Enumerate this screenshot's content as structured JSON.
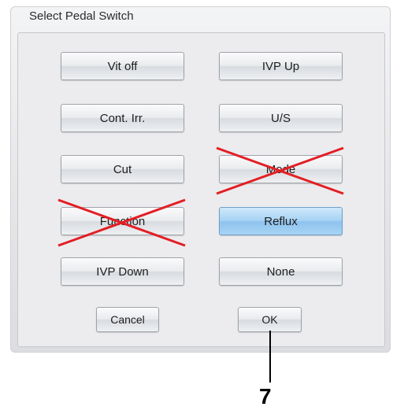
{
  "dialog": {
    "title": "Select Pedal Switch",
    "options": [
      {
        "label": "Vit off",
        "state": "normal"
      },
      {
        "label": "IVP Up",
        "state": "normal"
      },
      {
        "label": "Cont. Irr.",
        "state": "normal"
      },
      {
        "label": "U/S",
        "state": "normal"
      },
      {
        "label": "Cut",
        "state": "normal"
      },
      {
        "label": "Mode",
        "state": "crossed-out"
      },
      {
        "label": "Function",
        "state": "crossed-out"
      },
      {
        "label": "Reflux",
        "state": "selected"
      },
      {
        "label": "IVP Down",
        "state": "normal"
      },
      {
        "label": "None",
        "state": "normal"
      }
    ],
    "cancel_label": "Cancel",
    "ok_label": "OK"
  },
  "annotation": {
    "callout_label": "7"
  },
  "colors": {
    "selected_fill": "#a6d2f3",
    "cross_color": "#e31e24"
  }
}
